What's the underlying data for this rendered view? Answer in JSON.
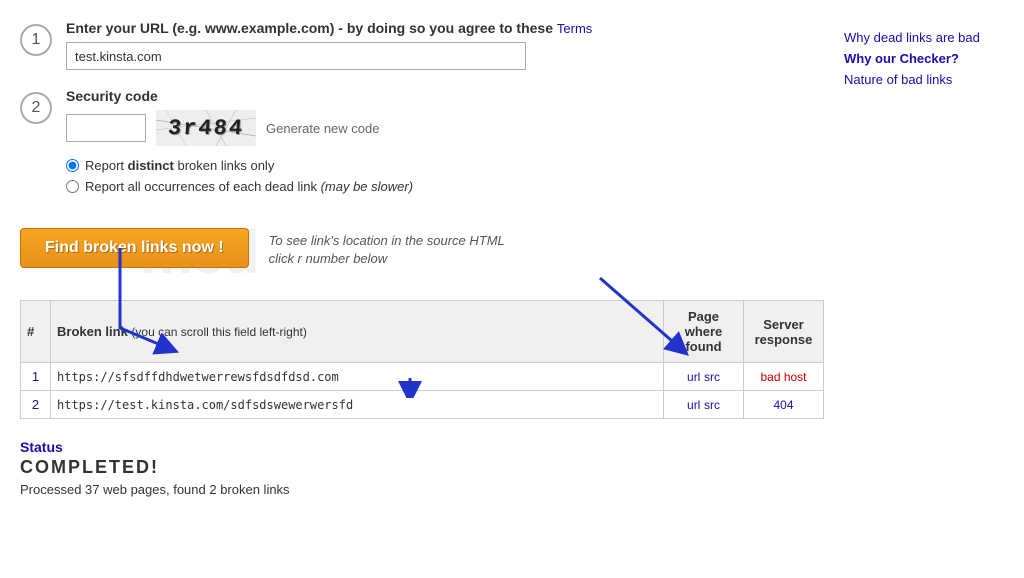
{
  "sidebar": {
    "links": [
      {
        "id": "why-dead",
        "label": "Why dead links are bad",
        "bold": false
      },
      {
        "id": "why-checker",
        "label": "Why our Checker?",
        "bold": true
      },
      {
        "id": "nature-bad",
        "label": "Nature of bad links",
        "bold": false
      }
    ]
  },
  "step1": {
    "number": "1",
    "label": "Enter your URL (e.g. www.example.com)",
    "note": " - by doing so you agree to these ",
    "terms_label": "Terms",
    "url_value": "test.kinsta.com",
    "url_placeholder": "test.kinsta.com"
  },
  "step2": {
    "number": "2",
    "label": "Security code",
    "captcha_text": "3r484",
    "generate_label": "Generate new code",
    "radio1_label": "Report ",
    "radio1_bold": "distinct",
    "radio1_rest": " broken links only",
    "radio2_label": "Report all occurrences of each dead link ",
    "radio2_italic": "(may be slower)"
  },
  "find_button": {
    "label": "Find broken links now !"
  },
  "tip": {
    "text": "To see link's location in the source HTML\nclick r number below"
  },
  "table": {
    "headers": {
      "num": "#",
      "broken_link": "Broken link",
      "broken_link_note": "(you can scroll this field left-right)",
      "page_where_found": "Page where found",
      "server_response": "Server response"
    },
    "rows": [
      {
        "num": "1",
        "url": "https://sfsdffdhdwetwerrewsfdsdfdsd.com",
        "page_url": "url",
        "page_src": "src",
        "server_response": "bad host",
        "response_type": "bad"
      },
      {
        "num": "2",
        "url": "https://test.kinsta.com/sdfsdswewerwersfd",
        "page_url": "url",
        "page_src": "src",
        "server_response": "404",
        "response_type": "404"
      }
    ]
  },
  "status": {
    "label": "Status",
    "completed": "COMPLETED!",
    "processed_text": "Processed 37 web pages, found 2 broken links"
  }
}
